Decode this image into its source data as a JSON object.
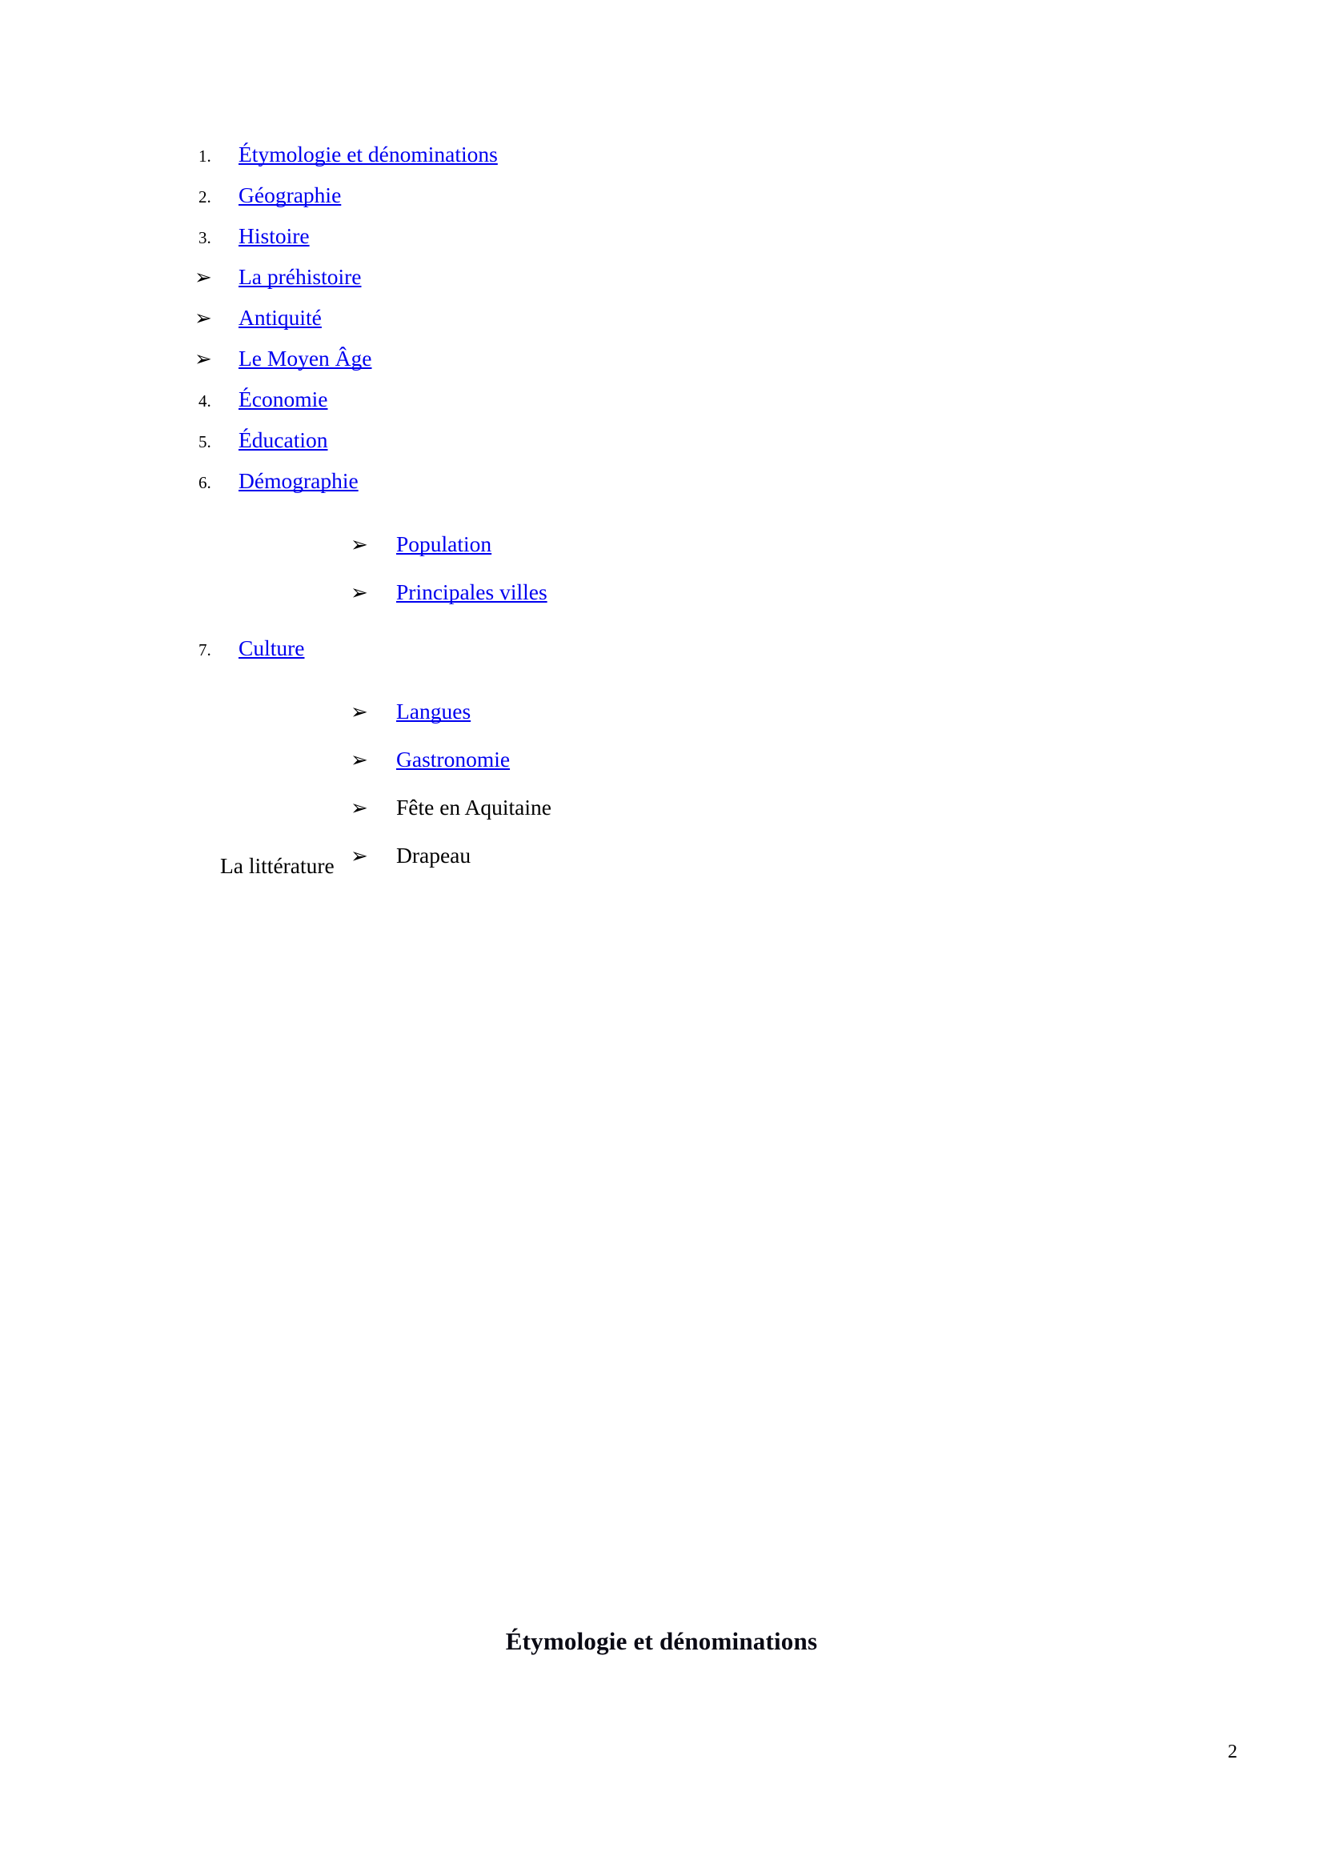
{
  "document": {
    "page_number": "2",
    "heading": "Étymologie et dénominations",
    "trailing_line": "La littérature",
    "link_color": "#0000EE",
    "text_color": "#000000",
    "background_color": "#FFFFFF"
  },
  "toc": {
    "items": [
      {
        "marker": "1.",
        "marker_type": "number",
        "label": "Étymologie et dénominations",
        "level": 1,
        "is_link": true
      },
      {
        "marker": "2.",
        "marker_type": "number",
        "label": "Géographie",
        "level": 1,
        "is_link": true
      },
      {
        "marker": "3.",
        "marker_type": "number",
        "label": "Histoire",
        "level": 1,
        "is_link": true
      },
      {
        "marker": "➢",
        "marker_type": "arrow",
        "label": "La préhistoire",
        "level": 1,
        "is_link": true
      },
      {
        "marker": "➢",
        "marker_type": "arrow",
        "label": "Antiquité",
        "level": 1,
        "is_link": true
      },
      {
        "marker": "➢",
        "marker_type": "arrow",
        "label": "Le Moyen Âge",
        "level": 1,
        "is_link": true
      },
      {
        "marker": "4.",
        "marker_type": "number",
        "label": "Économie",
        "level": 1,
        "is_link": true
      },
      {
        "marker": "5.",
        "marker_type": "number",
        "label": "Éducation",
        "level": 1,
        "is_link": true
      },
      {
        "marker": "6.",
        "marker_type": "number",
        "label": "Démographie",
        "level": 1,
        "is_link": true
      },
      {
        "marker": "➢",
        "marker_type": "arrow",
        "label": "Population",
        "level": 2,
        "is_link": true
      },
      {
        "marker": "➢",
        "marker_type": "arrow",
        "label": "Principales villes",
        "level": 2,
        "is_link": true
      },
      {
        "marker": "7.",
        "marker_type": "number",
        "label": "Culture",
        "level": 1,
        "is_link": true
      },
      {
        "marker": "➢",
        "marker_type": "arrow",
        "label": " Langues",
        "level": 2,
        "is_link": true
      },
      {
        "marker": "➢",
        "marker_type": "arrow",
        "label": "Gastronomie",
        "level": 2,
        "is_link": true
      },
      {
        "marker": "➢",
        "marker_type": "arrow",
        "label": "Fête en Aquitaine",
        "level": 2,
        "is_link": false
      },
      {
        "marker": "➢",
        "marker_type": "arrow",
        "label": "Drapeau",
        "level": 2,
        "is_link": false
      }
    ]
  }
}
